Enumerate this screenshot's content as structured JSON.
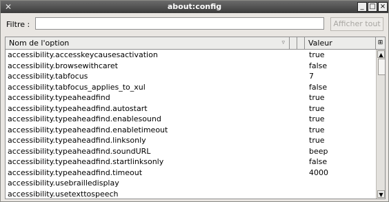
{
  "window": {
    "title": "about:config",
    "icon": "x-close-app-icon",
    "controls": [
      "_",
      "□",
      "×"
    ]
  },
  "filter": {
    "label": "Filtre :",
    "value": ""
  },
  "show_all_button": "Afficher tout",
  "columns": {
    "name": "Nom de l'option",
    "value": "Valeur"
  },
  "rows": [
    {
      "name": "accessibility.accesskeycausesactivation",
      "value": "true"
    },
    {
      "name": "accessibility.browsewithcaret",
      "value": "false"
    },
    {
      "name": "accessibility.tabfocus",
      "value": "7"
    },
    {
      "name": "accessibility.tabfocus_applies_to_xul",
      "value": "false"
    },
    {
      "name": "accessibility.typeaheadfind",
      "value": "true"
    },
    {
      "name": "accessibility.typeaheadfind.autostart",
      "value": "true"
    },
    {
      "name": "accessibility.typeaheadfind.enablesound",
      "value": "true"
    },
    {
      "name": "accessibility.typeaheadfind.enabletimeout",
      "value": "true"
    },
    {
      "name": "accessibility.typeaheadfind.linksonly",
      "value": "true"
    },
    {
      "name": "accessibility.typeaheadfind.soundURL",
      "value": "beep"
    },
    {
      "name": "accessibility.typeaheadfind.startlinksonly",
      "value": "false"
    },
    {
      "name": "accessibility.typeaheadfind.timeout",
      "value": "4000"
    },
    {
      "name": "accessibility.usebrailledisplay",
      "value": ""
    },
    {
      "name": "accessibility.usetexttospeech",
      "value": ""
    }
  ]
}
